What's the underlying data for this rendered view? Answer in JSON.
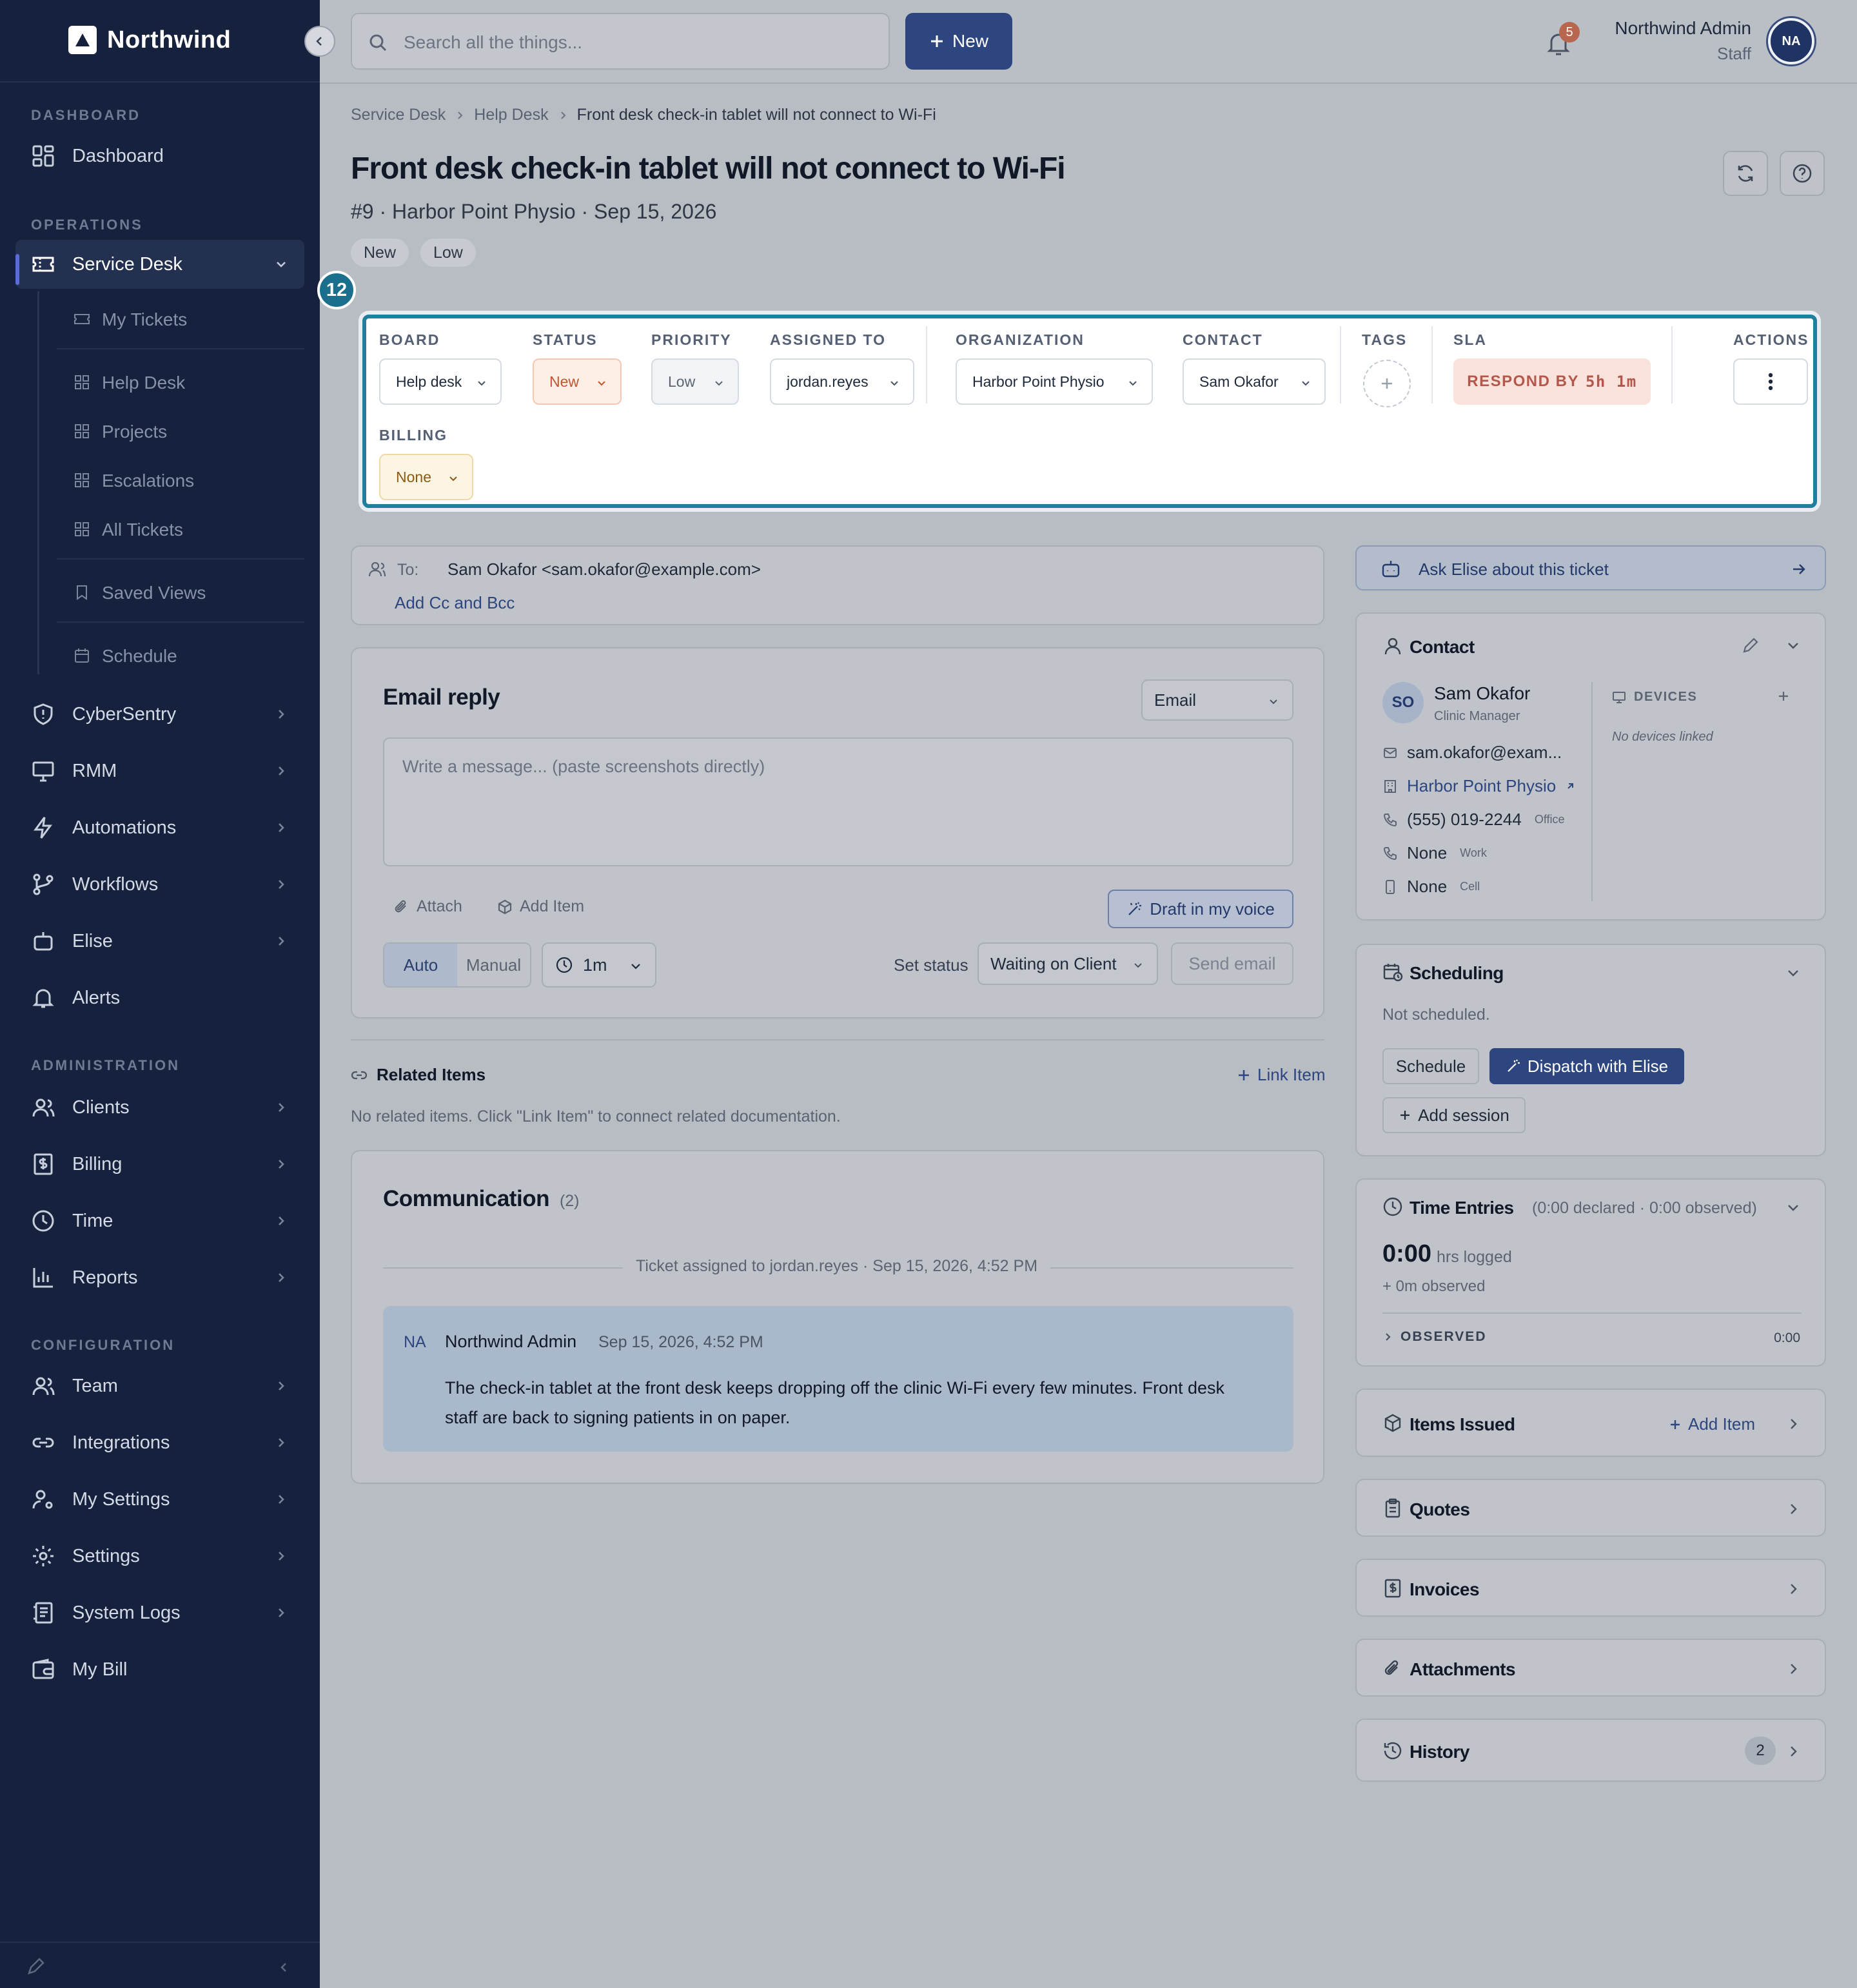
{
  "app": {
    "brand": "Northwind"
  },
  "sidebar": {
    "sections": {
      "dashboard": "DASHBOARD",
      "operations": "OPERATIONS",
      "administration": "ADMINISTRATION",
      "configuration": "CONFIGURATION"
    },
    "dashboard": "Dashboard",
    "service_desk": "Service Desk",
    "sub": {
      "my_tickets": "My Tickets",
      "help_desk": "Help Desk",
      "projects": "Projects",
      "escalations": "Escalations",
      "all_tickets": "All Tickets",
      "saved_views": "Saved Views",
      "schedule": "Schedule"
    },
    "ops": {
      "cybersentry": "CyberSentry",
      "rmm": "RMM",
      "automations": "Automations",
      "workflows": "Workflows",
      "elise": "Elise",
      "alerts": "Alerts"
    },
    "admin": {
      "clients": "Clients",
      "billing": "Billing",
      "time": "Time",
      "reports": "Reports"
    },
    "config": {
      "team": "Team",
      "integrations": "Integrations",
      "my_settings": "My Settings",
      "settings": "Settings",
      "system_logs": "System Logs",
      "my_bill": "My Bill"
    }
  },
  "topbar": {
    "search_placeholder": "Search all the things...",
    "new_label": "New",
    "notifications": "5",
    "user_name": "Northwind Admin",
    "user_role": "Staff",
    "avatar": "NA"
  },
  "breadcrumb": [
    "Service Desk",
    "Help Desk",
    "Front desk check-in tablet will not connect to Wi-Fi"
  ],
  "ticket": {
    "title": "Front desk check-in tablet will not connect to Wi-Fi",
    "subtitle": "#9 · Harbor Point Physio · Sep 15, 2026",
    "pills": [
      "New",
      "Low"
    ],
    "step": "12"
  },
  "fields": {
    "board": {
      "label": "BOARD",
      "value": "Help desk"
    },
    "status": {
      "label": "STATUS",
      "value": "New"
    },
    "priority": {
      "label": "PRIORITY",
      "value": "Low"
    },
    "assigned": {
      "label": "ASSIGNED TO",
      "value": "jordan.reyes"
    },
    "organization": {
      "label": "ORGANIZATION",
      "value": "Harbor Point Physio"
    },
    "contact": {
      "label": "CONTACT",
      "value": "Sam Okafor"
    },
    "tags": {
      "label": "TAGS"
    },
    "sla": {
      "label": "SLA",
      "prefix": "RESPOND BY",
      "time": "5h 1m"
    },
    "actions": {
      "label": "ACTIONS"
    },
    "billing": {
      "label": "BILLING",
      "value": "None"
    }
  },
  "recipients": {
    "to_label": "To:",
    "to_value": "Sam Okafor <sam.okafor@example.com>",
    "cc_link": "Add Cc and Bcc"
  },
  "reply": {
    "title": "Email reply",
    "channel": "Email",
    "placeholder": "Write a message... (paste screenshots directly)",
    "attach": "Attach",
    "add_item": "Add Item",
    "draft": "Draft in my voice",
    "mode_auto": "Auto",
    "mode_manual": "Manual",
    "delay": "1m",
    "set_status_label": "Set status",
    "set_status_value": "Waiting on Client",
    "send": "Send email"
  },
  "related": {
    "title": "Related Items",
    "link": "Link Item",
    "empty": "No related items. Click \"Link Item\" to connect related documentation."
  },
  "communication": {
    "title": "Communication",
    "count": "(2)",
    "event": "Ticket assigned to jordan.reyes · Sep 15, 2026, 4:52 PM",
    "message": {
      "initials": "NA",
      "author": "Northwind Admin",
      "time": "Sep 15, 2026, 4:52 PM",
      "body_1": "The check-in tablet at the front desk keeps dropping off the clinic Wi-Fi every few minutes. Front desk",
      "body_2": "staff are back to signing patients in on paper."
    }
  },
  "right": {
    "ask_elise": "Ask Elise about this ticket",
    "contact": {
      "title": "Contact",
      "initials": "SO",
      "name": "Sam Okafor",
      "role": "Clinic Manager",
      "email": "sam.okafor@exam...",
      "org": "Harbor Point Physio",
      "phone": "(555) 019-2244",
      "phone_type": "Office",
      "work": "None",
      "work_type": "Work",
      "cell": "None",
      "cell_type": "Cell",
      "devices_label": "DEVICES",
      "devices_empty": "No devices linked"
    },
    "scheduling": {
      "title": "Scheduling",
      "status": "Not scheduled.",
      "schedule": "Schedule",
      "dispatch": "Dispatch with Elise",
      "add_session": "Add session"
    },
    "time": {
      "title": "Time Entries",
      "summary": "(0:00 declared · 0:00 observed)",
      "value": "0:00",
      "unit": "hrs logged",
      "observed_note": "+ 0m observed",
      "observed_label": "OBSERVED",
      "observed_value": "0:00"
    },
    "items_issued": {
      "title": "Items Issued",
      "add": "Add Item"
    },
    "quotes": "Quotes",
    "invoices": "Invoices",
    "attachments": "Attachments",
    "history": {
      "title": "History",
      "count": "2"
    }
  },
  "colors": {
    "sidebar": "#16213d",
    "accent": "#2d4680",
    "highlight": "#1f7f9e",
    "sla": "#b5584c"
  }
}
